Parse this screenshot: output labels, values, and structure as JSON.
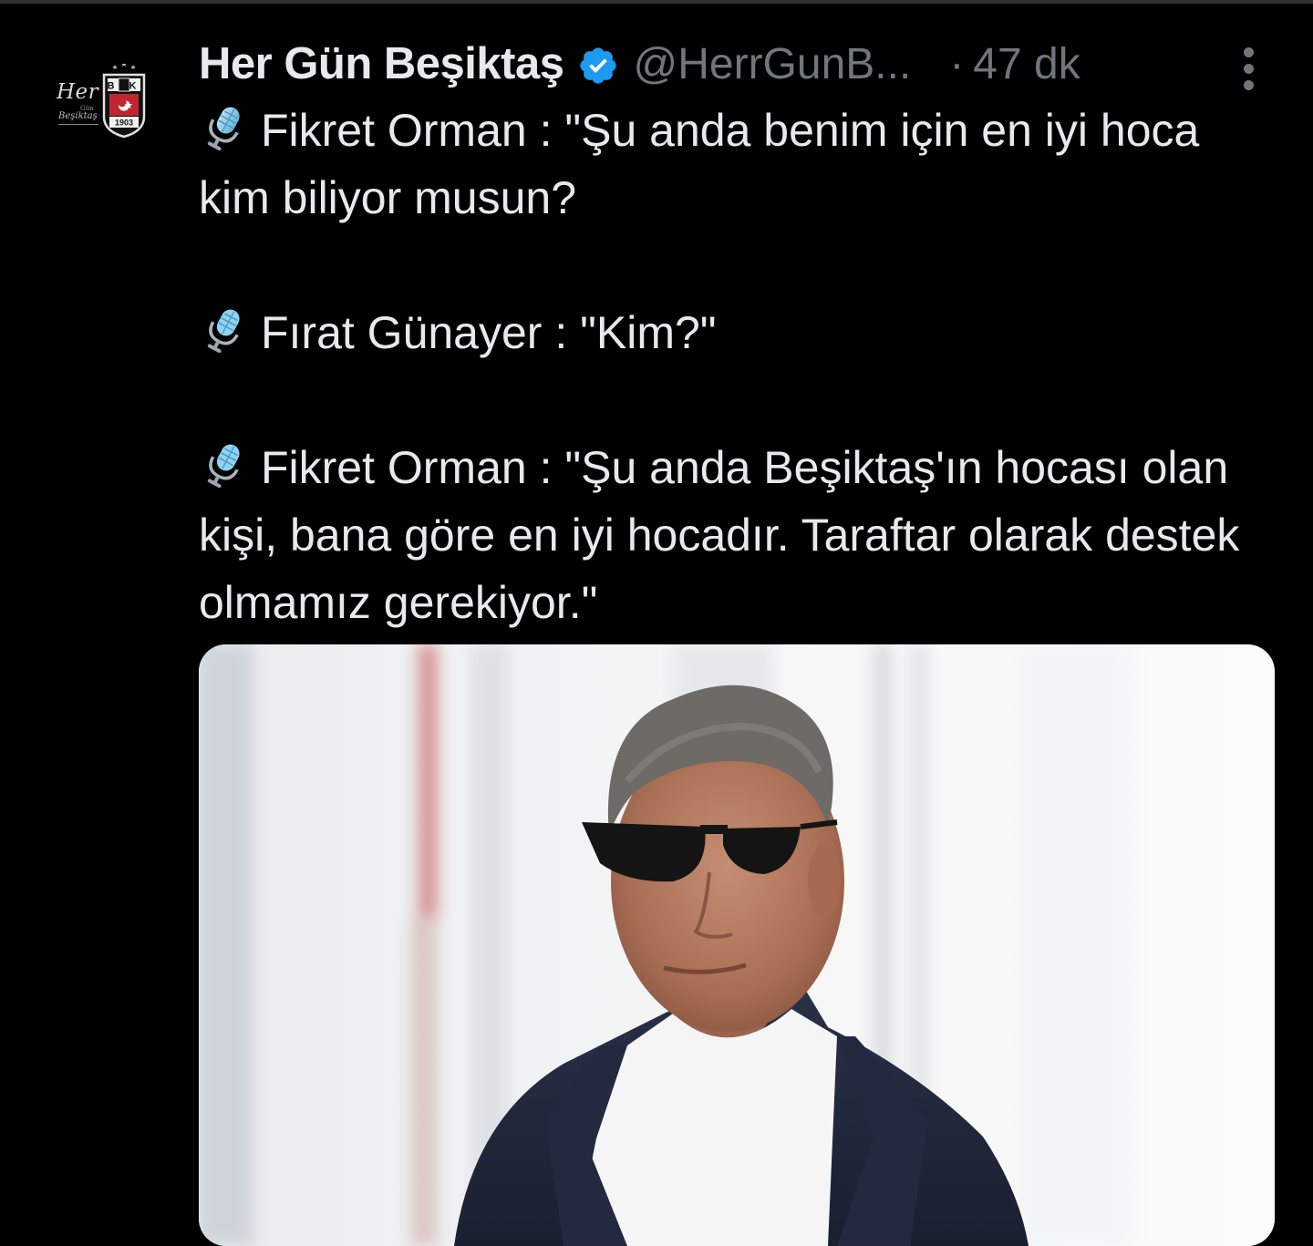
{
  "tweet": {
    "author": {
      "display_name": "Her Gün Beşiktaş",
      "handle": "@HerrGunB...",
      "verified": true,
      "avatar_icon": "besiktas-crest-logo",
      "avatar_text": {
        "line1": "Her",
        "line2": "Gün",
        "line3": "Beşiktaş",
        "crest_letters": "BJK",
        "crest_year": "1903"
      }
    },
    "separator": "·",
    "timestamp": "47 dk",
    "more_icon": "more-vertical-icon",
    "paragraphs": [
      {
        "icon": "microphone-icon",
        "text": "Fikret Orman : \"Şu anda benim için en iyi hoca kim biliyor musun?"
      },
      {
        "icon": "microphone-icon",
        "text": "Fırat Günayer : \"Kim?\""
      },
      {
        "icon": "microphone-icon",
        "text": "Fikret Orman : \"Şu anda Beşiktaş'ın hocası olan kişi, bana göre en iyi hocadır. Taraftar olarak destek olmamız gerekiyor.\""
      }
    ],
    "media": {
      "type": "photo",
      "subject": "man-in-sunglasses-photo"
    }
  },
  "colors": {
    "background": "#000000",
    "text_primary": "#e7e9ea",
    "text_secondary": "#71767b",
    "verified_blue": "#1d9bf0",
    "mic_blue": "#8fd3f4"
  }
}
